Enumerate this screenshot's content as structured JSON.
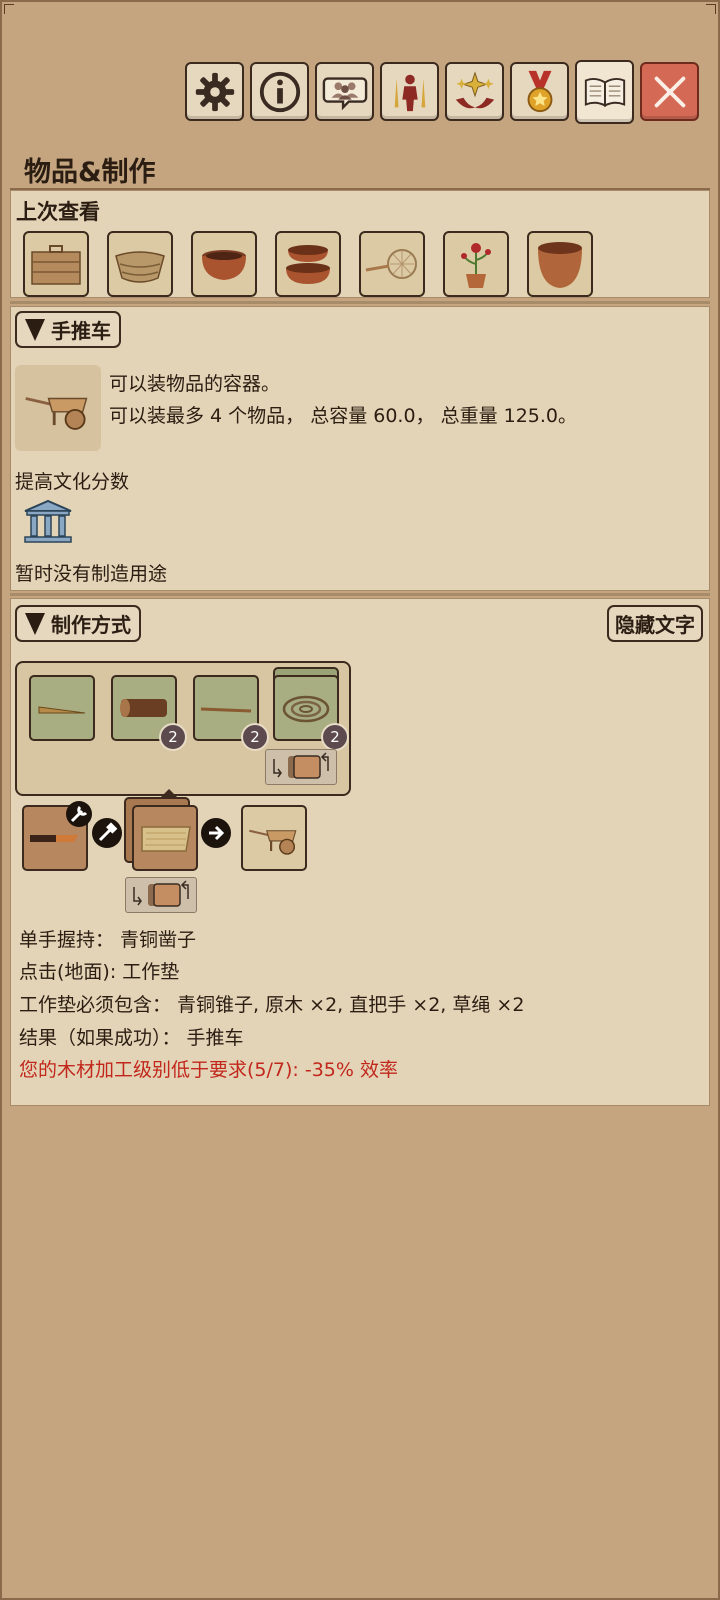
{
  "app": {
    "title": "物品&制作"
  },
  "toolbar": {
    "buttons": [
      {
        "icon": "gear-icon"
      },
      {
        "icon": "info-icon"
      },
      {
        "icon": "chat-people-icon"
      },
      {
        "icon": "character-icon"
      },
      {
        "icon": "sparkle-hands-icon"
      },
      {
        "icon": "medal-icon"
      },
      {
        "icon": "book-icon"
      },
      {
        "icon": "close-icon"
      }
    ],
    "close_color": "#d46a55"
  },
  "recent": {
    "title": "上次查看",
    "items": [
      {
        "icon": "wooden-box-icon"
      },
      {
        "icon": "basket-icon"
      },
      {
        "icon": "clay-pot-icon"
      },
      {
        "icon": "stacked-pots-icon"
      },
      {
        "icon": "fishing-net-icon"
      },
      {
        "icon": "potted-rose-icon"
      },
      {
        "icon": "clay-bowl-icon"
      }
    ]
  },
  "item": {
    "header": "手推车",
    "desc1": "可以装物品的容器。",
    "desc2": "可以装最多 4 个物品， 总容量 60.0， 总重量 125.0。",
    "culture": "提高文化分数",
    "no_use": "暂时没有制造用途",
    "icon": "wheelbarrow-icon"
  },
  "recipe": {
    "header": "制作方式",
    "hide_text": "隐藏文字",
    "ingredients": [
      {
        "icon": "bronze-awl-icon",
        "count": ""
      },
      {
        "icon": "log-icon",
        "count": "2"
      },
      {
        "icon": "straight-handle-icon",
        "count": "2"
      },
      {
        "icon": "grass-rope-icon",
        "count": "2"
      }
    ],
    "lines": {
      "hold": "单手握持： 青铜凿子",
      "click": "点击(地面): 工作垫",
      "must": "工作垫必须包含： 青铜锥子, 原木 ×2, 直把手 ×2, 草绳 ×2",
      "result": "结果（如果成功）： 手推车",
      "warning": "您的木材加工级别低于要求(5/7): -35% 效率"
    },
    "warning_color": "#c2271c"
  }
}
